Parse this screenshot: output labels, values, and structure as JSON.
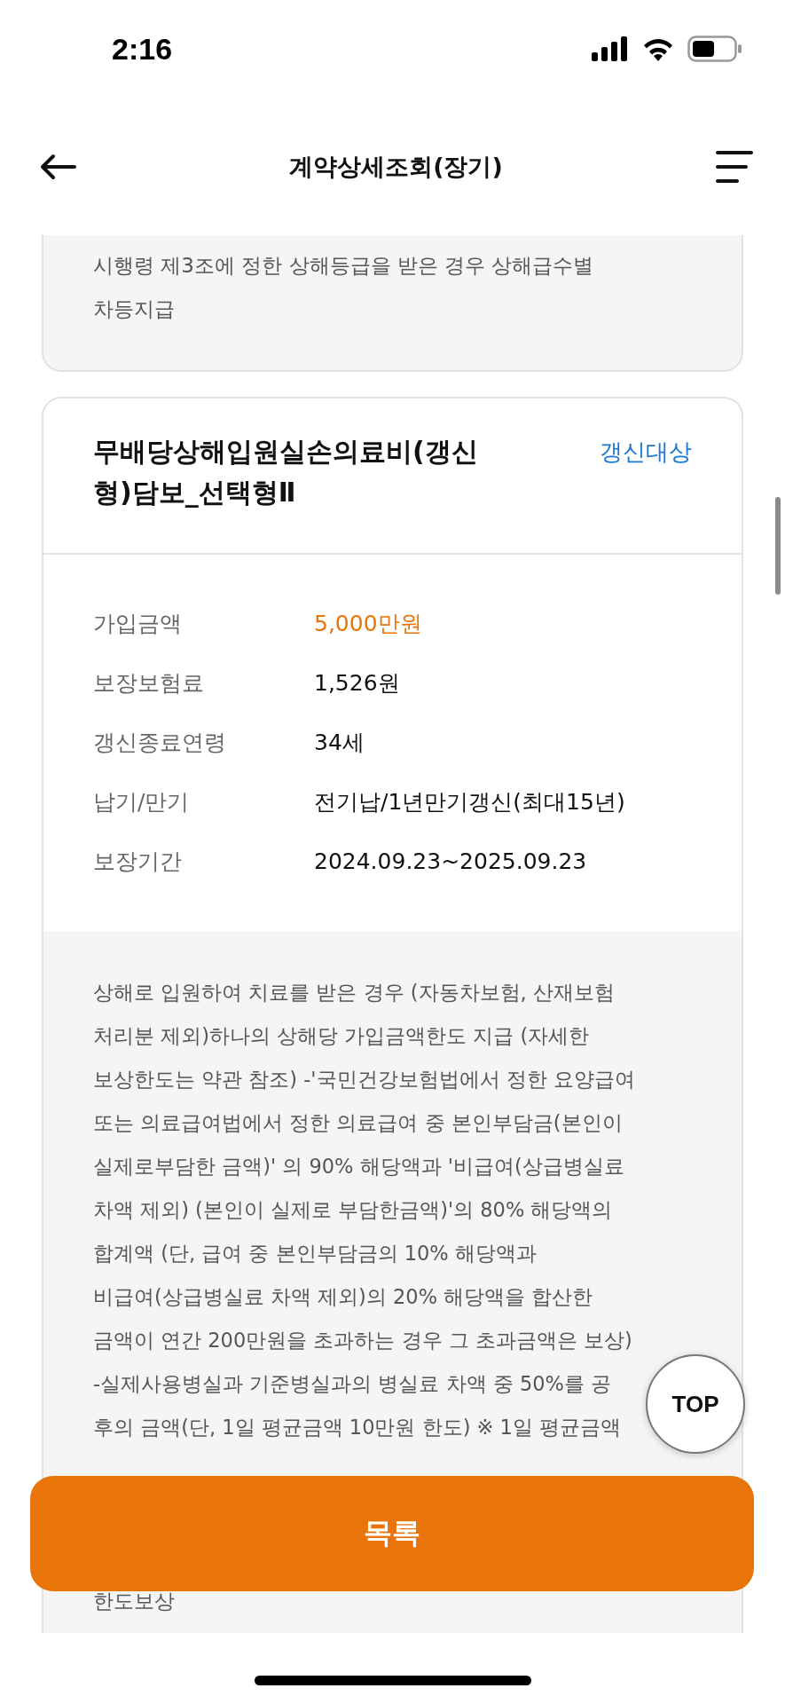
{
  "status_bar": {
    "time": "2:16"
  },
  "header": {
    "title": "계약상세조회(장기)"
  },
  "previous_card": {
    "lines": [
      "시행령 제3조에 정한 상해등급을 받은 경우 상해급수별",
      "차등지급"
    ]
  },
  "coverage_card": {
    "title": "무배당상해입원실손의료비(갱신형)담보_선택형Ⅱ",
    "badge": "갱신대상",
    "rows": [
      {
        "label": "가입금액",
        "value": "5,000만원",
        "kind": "highlight"
      },
      {
        "label": "보장보험료",
        "value": "1,526원",
        "kind": "plain"
      },
      {
        "label": "갱신종료연령",
        "value": "34세",
        "kind": "plain"
      },
      {
        "label": "납기/만기",
        "value": "전기납/1년만기갱신(최대15년)",
        "kind": "plain"
      },
      {
        "label": "보장기간",
        "value": "2024.09.23~2025.09.23",
        "kind": "plain"
      }
    ],
    "description": {
      "lines": [
        "상해로 입원하여 치료를 받은 경우 (자동차보험, 산재보험",
        "처리분 제외)하나의 상해당 가입금액한도 지급 (자세한",
        "보상한도는 약관 참조) -'국민건강보험법에서 정한 요양급여",
        "또는 의료급여법에서 정한 의료급여 중 본인부담금(본인이",
        "실제로부담한 금액)' 의 90% 해당액과 '비급여(상급병실료",
        "차액 제외) (본인이 실제로 부담한금액)'의 80% 해당액의",
        "합계액 (단, 급여 중 본인부담금의 10% 해당액과",
        "비급여(상급병실료 차액 제외)의 20% 해당액을 합산한",
        "금액이 연간 200만원을 초과하는 경우 그 초과금액은 보상)",
        "-실제사용병실과 기준병실과의 병실료 차액 중 50%를 공",
        "후의 금액(단, 1일 평균금액 10만원 한도) ※ 1일 평균금액"
      ],
      "tail": "한도보상"
    }
  },
  "top_button": "TOP",
  "list_button": "목록"
}
